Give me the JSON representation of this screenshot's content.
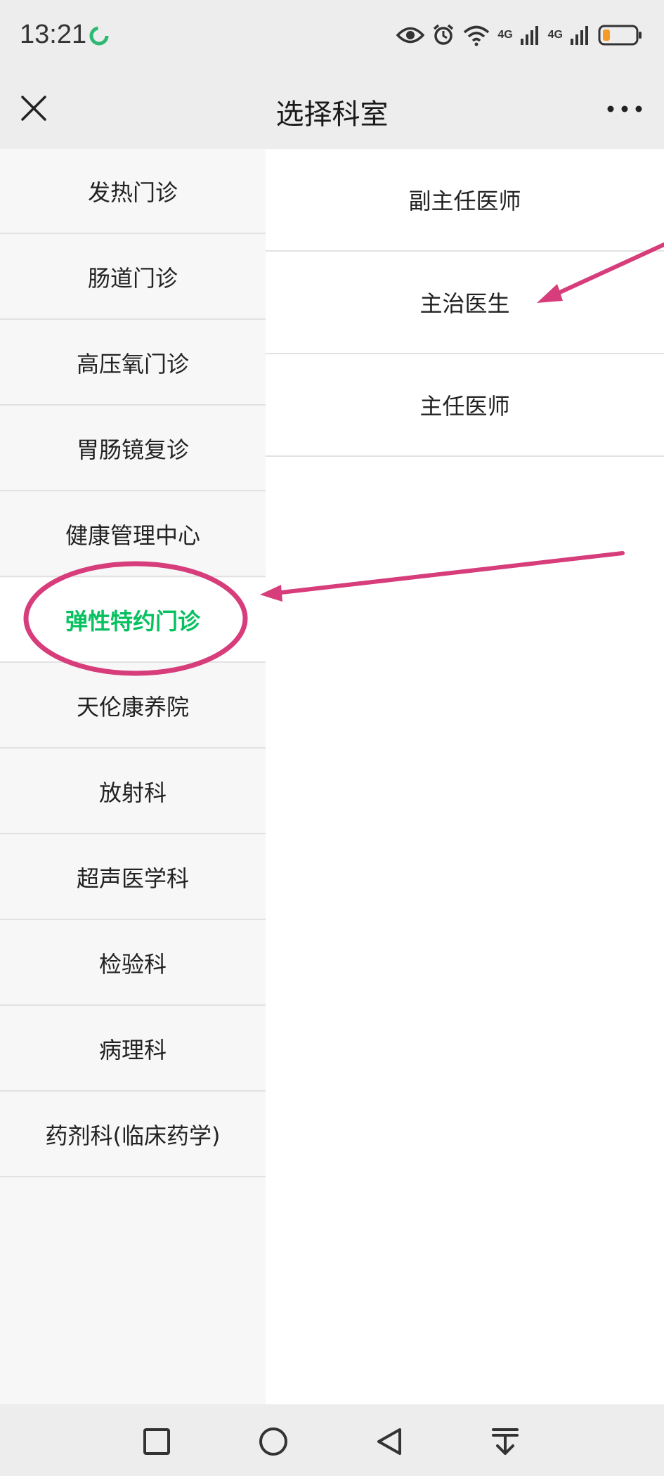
{
  "status_bar": {
    "time": "13:21",
    "network_1": "4G",
    "network_2": "4G",
    "battery_color": "#f59a23"
  },
  "header": {
    "title": "选择科室",
    "close_icon": "close-icon",
    "more_icon": "more-icon"
  },
  "departments": [
    {
      "label": "发热门诊"
    },
    {
      "label": "肠道门诊"
    },
    {
      "label": "高压氧门诊"
    },
    {
      "label": "胃肠镜复诊"
    },
    {
      "label": "健康管理中心"
    },
    {
      "label": "弹性特约门诊",
      "selected": true
    },
    {
      "label": "天伦康养院"
    },
    {
      "label": "放射科"
    },
    {
      "label": "超声医学科"
    },
    {
      "label": "检验科"
    },
    {
      "label": "病理科"
    },
    {
      "label": "药剂科(临床药学)"
    }
  ],
  "doctor_levels": [
    {
      "label": "副主任医师"
    },
    {
      "label": "主治医生"
    },
    {
      "label": "主任医师"
    }
  ],
  "colors": {
    "accent": "#07c160",
    "annotation": "#d63d7a",
    "page_bg": "#ededed"
  },
  "system_nav": [
    "square-icon",
    "circle-icon",
    "back-triangle-icon",
    "download-icon"
  ]
}
